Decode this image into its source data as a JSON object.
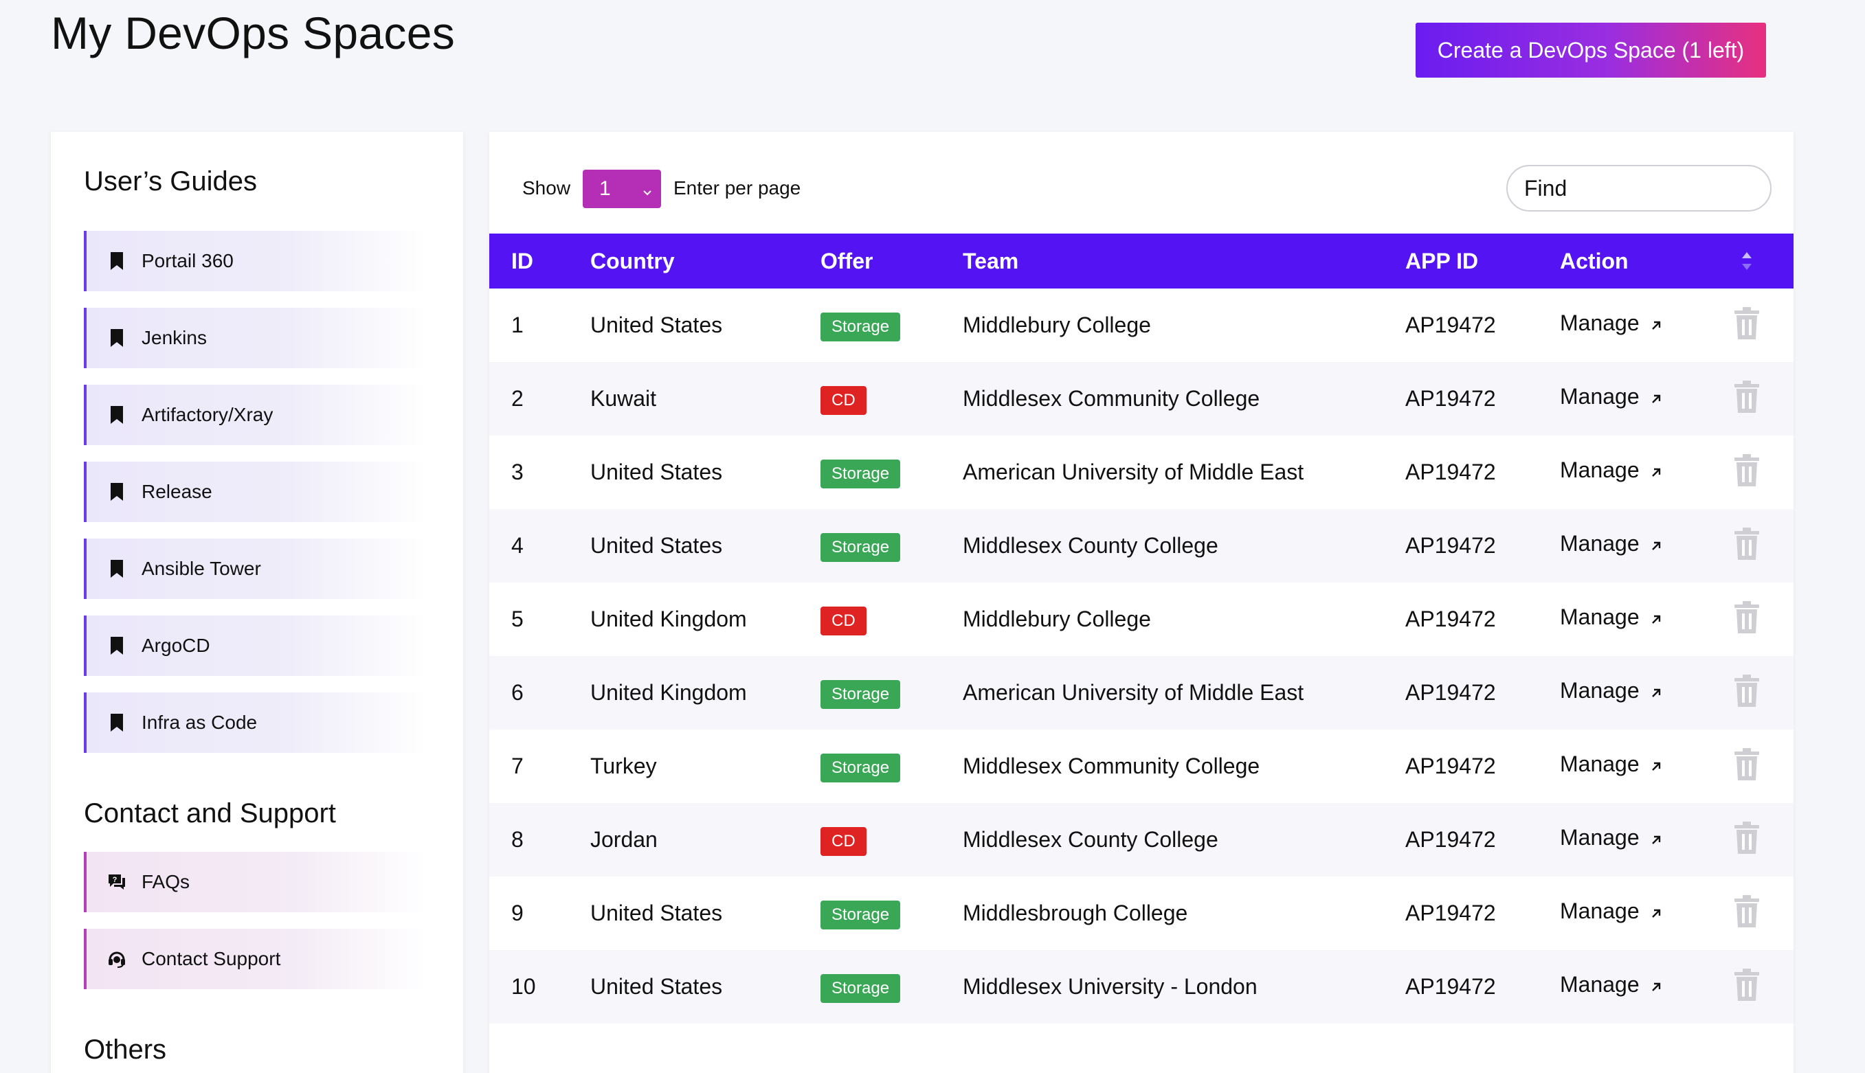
{
  "header": {
    "title": "My DevOps Spaces",
    "create_button": "Create a DevOps Space (1 left)"
  },
  "sidebar": {
    "guides_title": "User’s Guides",
    "guides": [
      {
        "label": "Portail 360",
        "icon": "bookmark-icon"
      },
      {
        "label": "Jenkins",
        "icon": "bookmark-icon"
      },
      {
        "label": "Artifactory/Xray",
        "icon": "bookmark-icon"
      },
      {
        "label": "Release",
        "icon": "bookmark-icon"
      },
      {
        "label": "Ansible Tower",
        "icon": "bookmark-icon"
      },
      {
        "label": "ArgoCD",
        "icon": "bookmark-icon"
      },
      {
        "label": "Infra as Code",
        "icon": "bookmark-icon"
      }
    ],
    "support_title": "Contact and Support",
    "support": [
      {
        "label": "FAQs",
        "icon": "faq-chat-icon"
      },
      {
        "label": "Contact Support",
        "icon": "headset-icon"
      }
    ],
    "others_title": "Others"
  },
  "toolbar": {
    "show_label": "Show",
    "per_page_value": "1",
    "per_page_suffix": "Enter per page",
    "find_placeholder": "Find"
  },
  "table": {
    "headers": [
      "ID",
      "Country",
      "Offer",
      "Team",
      "APP ID",
      "Action"
    ],
    "action_label": "Manage",
    "rows": [
      {
        "id": "1",
        "country": "United States",
        "offer": "Storage",
        "team": "Middlebury College",
        "app_id": "AP19472"
      },
      {
        "id": "2",
        "country": "Kuwait",
        "offer": "CD",
        "team": "Middlesex Community College",
        "app_id": "AP19472"
      },
      {
        "id": "3",
        "country": "United States",
        "offer": "Storage",
        "team": "American University of Middle East",
        "app_id": "AP19472"
      },
      {
        "id": "4",
        "country": "United States",
        "offer": "Storage",
        "team": "Middlesex County College",
        "app_id": "AP19472"
      },
      {
        "id": "5",
        "country": "United Kingdom",
        "offer": "CD",
        "team": "Middlebury College",
        "app_id": "AP19472"
      },
      {
        "id": "6",
        "country": "United Kingdom",
        "offer": "Storage",
        "team": "American University of Middle East",
        "app_id": "AP19472"
      },
      {
        "id": "7",
        "country": "Turkey",
        "offer": "Storage",
        "team": "Middlesex Community College",
        "app_id": "AP19472"
      },
      {
        "id": "8",
        "country": "Jordan",
        "offer": "CD",
        "team": "Middlesex County College",
        "app_id": "AP19472"
      },
      {
        "id": "9",
        "country": "United States",
        "offer": "Storage",
        "team": "Middlesbrough College",
        "app_id": "AP19472"
      },
      {
        "id": "10",
        "country": "United States",
        "offer": "Storage",
        "team": "Middlesex University - London",
        "app_id": "AP19472"
      }
    ]
  },
  "colors": {
    "header_bg": "#5313f2",
    "storage_badge": "#3aa757",
    "cd_badge": "#df2222",
    "select_bg": "#b52fb6",
    "guide_accent": "#6a3ce8",
    "support_accent": "#b43fb4"
  }
}
